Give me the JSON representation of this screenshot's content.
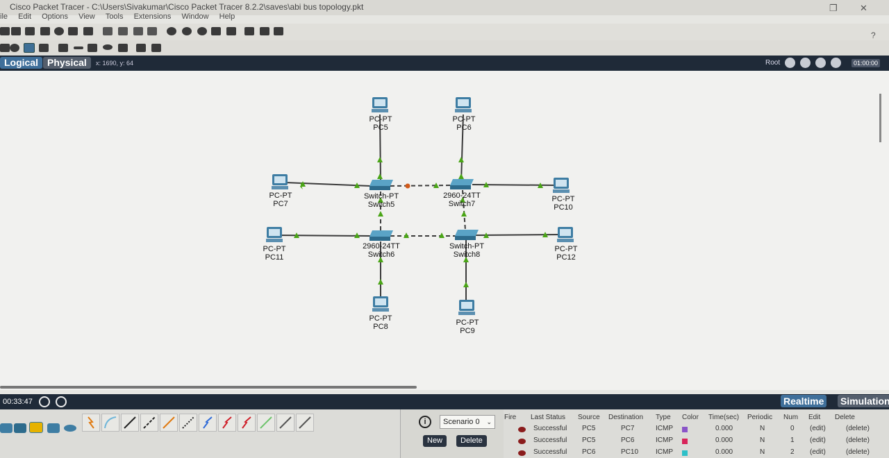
{
  "window": {
    "title": "Cisco Packet Tracer - C:\\Users\\Sivakumar\\Cisco Packet Tracer 8.2.2\\saves\\abi bus topology.pkt",
    "restore_glyph": "❐",
    "close_glyph": "✕"
  },
  "menu": [
    "ile",
    "Edit",
    "Options",
    "View",
    "Tools",
    "Extensions",
    "Window",
    "Help"
  ],
  "help_glyph": "?",
  "modes": {
    "logical": "Logical",
    "physical": "Physical",
    "coords": "x: 1690, y: 64"
  },
  "top_right": {
    "root": "Root",
    "time": "01:00:00"
  },
  "topology": {
    "devices": [
      {
        "id": "pc5",
        "type": "pc",
        "model": "PC-PT",
        "name": "PC5"
      },
      {
        "id": "pc6",
        "type": "pc",
        "model": "PC-PT",
        "name": "PC6"
      },
      {
        "id": "pc7",
        "type": "pc",
        "model": "PC-PT",
        "name": "PC7"
      },
      {
        "id": "pc10",
        "type": "pc",
        "model": "PC-PT",
        "name": "PC10"
      },
      {
        "id": "pc11",
        "type": "pc",
        "model": "PC-PT",
        "name": "PC11"
      },
      {
        "id": "pc12",
        "type": "pc",
        "model": "PC-PT",
        "name": "PC12"
      },
      {
        "id": "pc8",
        "type": "pc",
        "model": "PC-PT",
        "name": "PC8"
      },
      {
        "id": "pc9",
        "type": "pc",
        "model": "PC-PT",
        "name": "PC9"
      },
      {
        "id": "sw5",
        "type": "switch",
        "model": "Switch-PT",
        "name": "Switch5"
      },
      {
        "id": "sw7",
        "type": "switch",
        "model": "2960-24TT",
        "name": "Switch7"
      },
      {
        "id": "sw6",
        "type": "switch",
        "model": "2960-24TT",
        "name": "Switch6"
      },
      {
        "id": "sw8",
        "type": "switch",
        "model": "Switch-PT",
        "name": "Switch8"
      }
    ]
  },
  "sim": {
    "timer": "00:33:47",
    "realtime": "Realtime",
    "simulation": "Simulation"
  },
  "scenario": {
    "label": "Scenario 0",
    "new": "New",
    "delete": "Delete"
  },
  "pdu": {
    "headers": [
      "Fire",
      "Last Status",
      "Source",
      "Destination",
      "Type",
      "Color",
      "Time(sec)",
      "Periodic",
      "Num",
      "Edit",
      "Delete"
    ],
    "rows": [
      {
        "status": "Successful",
        "source": "PC5",
        "destination": "PC7",
        "type": "ICMP",
        "color": "#8a55c8",
        "time": "0.000",
        "periodic": "N",
        "num": "0",
        "edit": "(edit)",
        "delete": "(delete)"
      },
      {
        "status": "Successful",
        "source": "PC5",
        "destination": "PC6",
        "type": "ICMP",
        "color": "#d8245a",
        "time": "0.000",
        "periodic": "N",
        "num": "1",
        "edit": "(edit)",
        "delete": "(delete)"
      },
      {
        "status": "Successful",
        "source": "PC6",
        "destination": "PC10",
        "type": "ICMP",
        "color": "#2ec0c8",
        "time": "0.000",
        "periodic": "N",
        "num": "2",
        "edit": "(edit)",
        "delete": "(delete)"
      }
    ]
  },
  "colors": {
    "link": "#3a3a3a",
    "port_up": "#4aa516",
    "port_blocked": "#d05a1a",
    "device": "#3e7da3",
    "panel_dark": "#1f2a38"
  }
}
